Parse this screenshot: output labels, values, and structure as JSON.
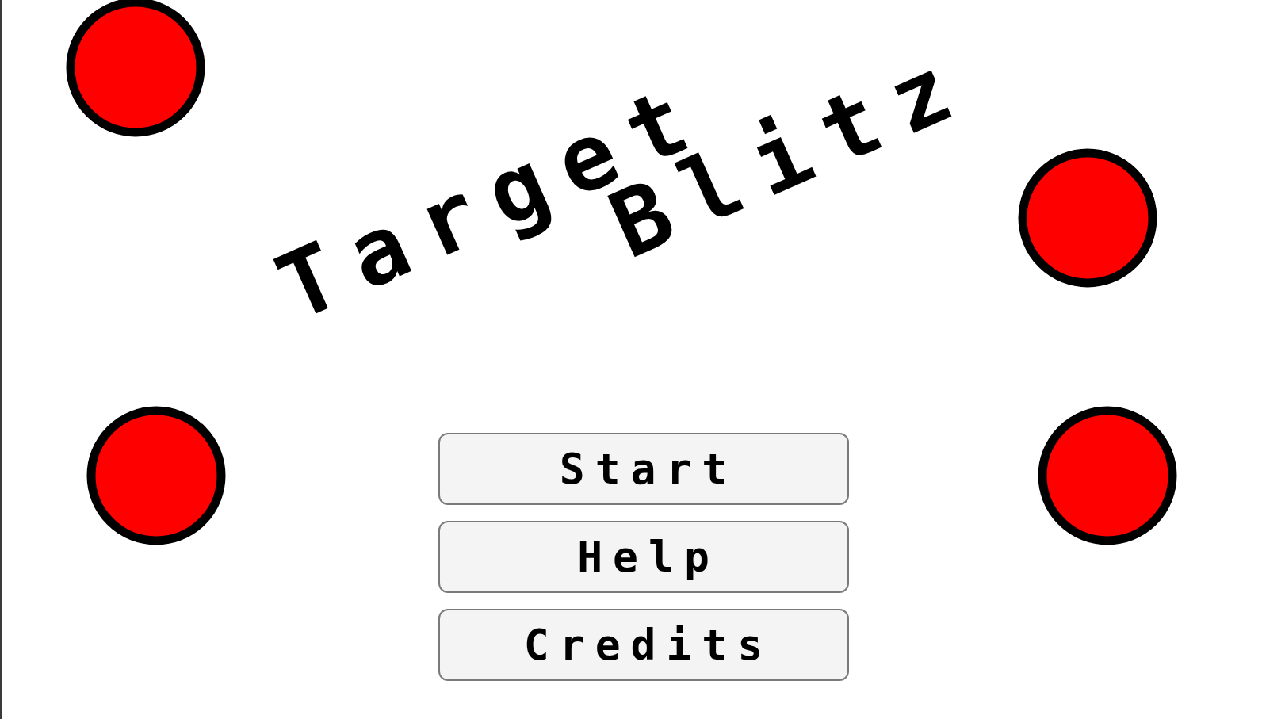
{
  "title": {
    "words": [
      "Target",
      "Blitz"
    ]
  },
  "menu": [
    {
      "label": "Start"
    },
    {
      "label": "Help"
    },
    {
      "label": "Credits"
    }
  ]
}
